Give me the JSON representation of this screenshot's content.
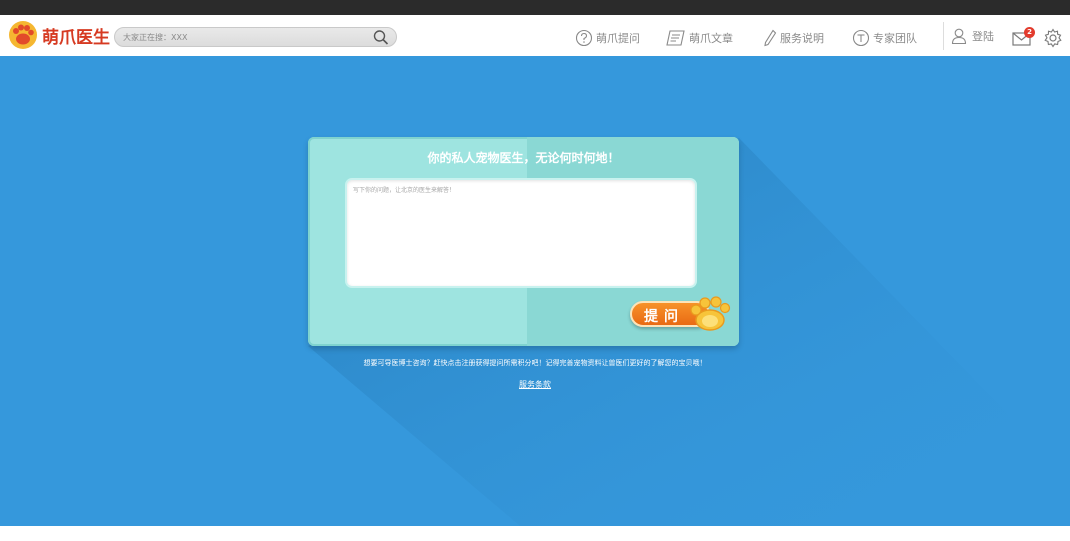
{
  "header": {
    "logo_text": "萌爪医生",
    "search_placeholder": "大家正在搜：XXX",
    "nav": [
      {
        "label": "萌爪提问",
        "icon": "question-icon"
      },
      {
        "label": "萌爪文章",
        "icon": "article-icon"
      },
      {
        "label": "服务说明",
        "icon": "pencil-icon"
      },
      {
        "label": "专家团队",
        "icon": "team-icon"
      }
    ],
    "login_label": "登陆",
    "mail_badge": "2",
    "colors": {
      "logo": "#d63a22",
      "nav_text": "#8a8a8a",
      "badge": "#e23b2d"
    }
  },
  "main": {
    "background": "#3598dc",
    "card": {
      "title": "你的私人宠物医生，无论何时何地！",
      "textarea_placeholder": "写下你的问题，让北京的医生来解答！",
      "ask_button": "提问",
      "colors": {
        "card": "#9ee4e0",
        "button": "#f08020"
      }
    },
    "info_text": "想要可导医博士咨询？赶快点击注册获得提问所需积分吧！记得完善宠物资料让兽医们更好的了解您的宝贝哦！",
    "terms_link": "服务条款"
  }
}
